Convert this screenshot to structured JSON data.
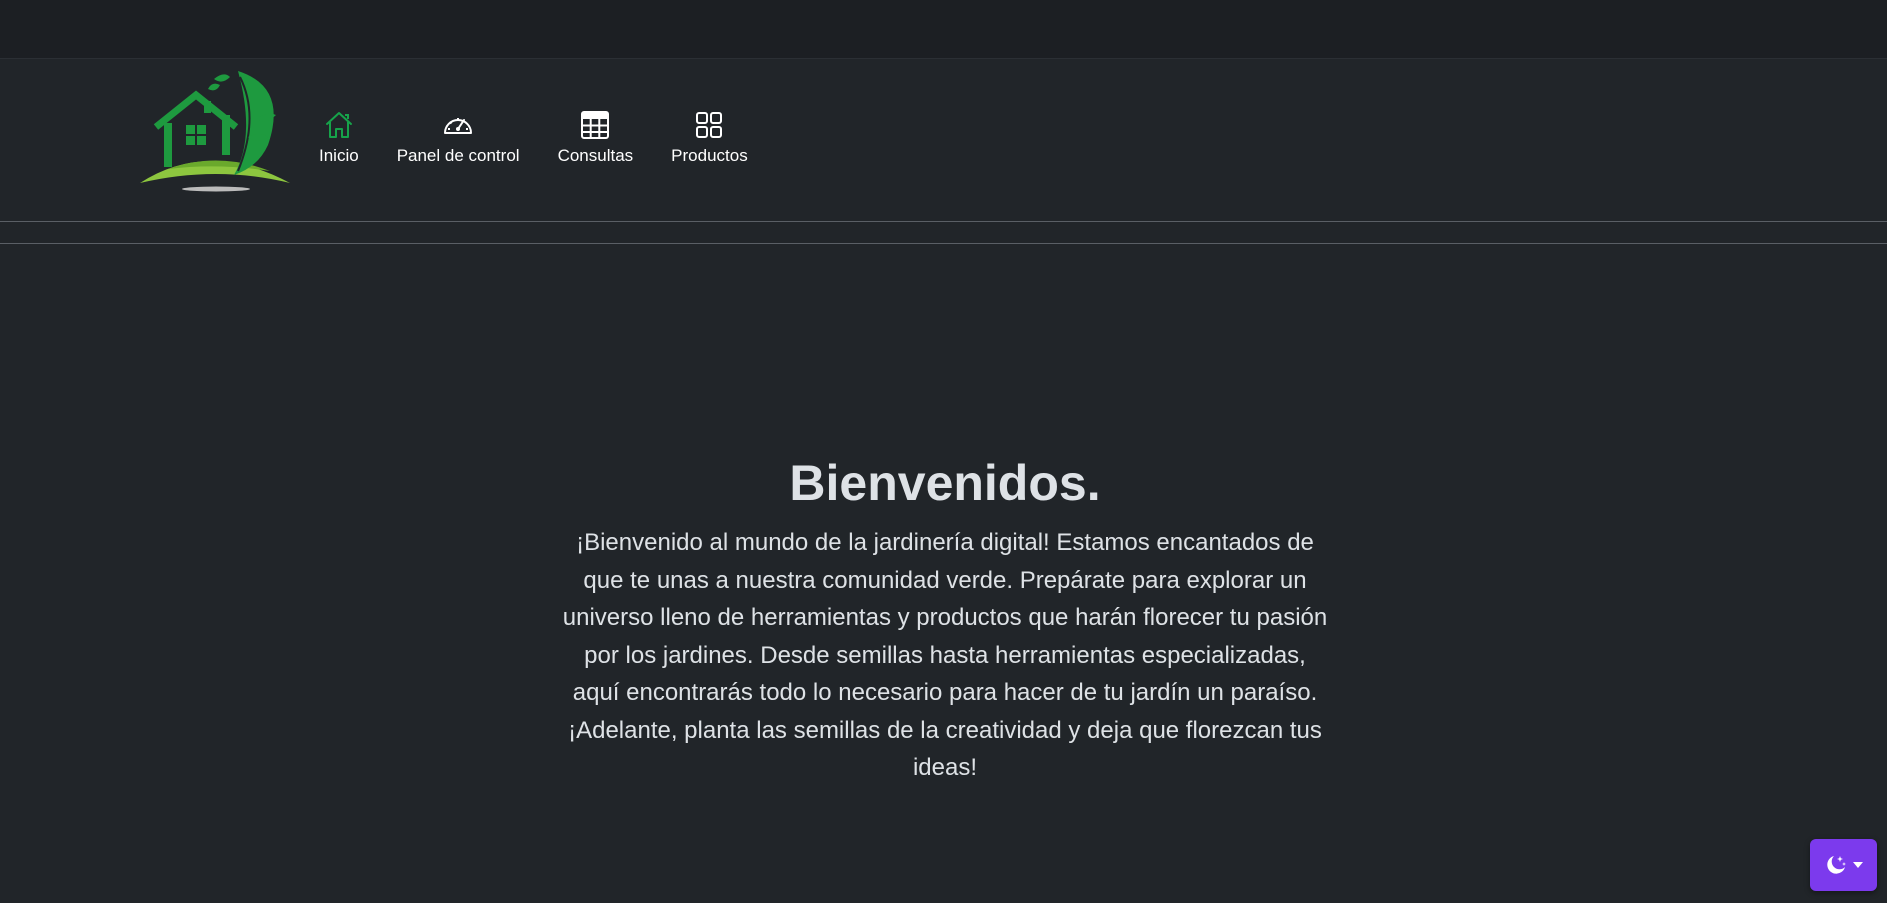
{
  "nav": {
    "items": [
      {
        "label": "Inicio",
        "icon": "home-icon",
        "active": true,
        "color": "#16a34a"
      },
      {
        "label": "Panel de control",
        "icon": "speedometer-icon",
        "active": false,
        "color": "#ffffff"
      },
      {
        "label": "Consultas",
        "icon": "table-icon",
        "active": false,
        "color": "#ffffff"
      },
      {
        "label": "Productos",
        "icon": "grid-icon",
        "active": false,
        "color": "#ffffff"
      }
    ]
  },
  "hero": {
    "title": "Bienvenidos.",
    "text": "¡Bienvenido al mundo de la jardinería digital! Estamos encantados de que te unas a nuestra comunidad verde. Prepárate para explorar un universo lleno de herramientas y productos que harán florecer tu pasión por los jardines. Desde semillas hasta herramientas especializadas, aquí encontrarás todo lo necesario para hacer de tu jardín un paraíso. ¡Adelante, planta las semillas de la creatividad y deja que florezcan tus ideas!"
  },
  "theme_toggle": {
    "icon": "moon-stars-icon",
    "dropdown_icon": "caret-down-icon",
    "color": "#7c3aed"
  },
  "colors": {
    "background": "#212529",
    "brand_green": "#15803d",
    "grass_green": "#8dc63f"
  }
}
